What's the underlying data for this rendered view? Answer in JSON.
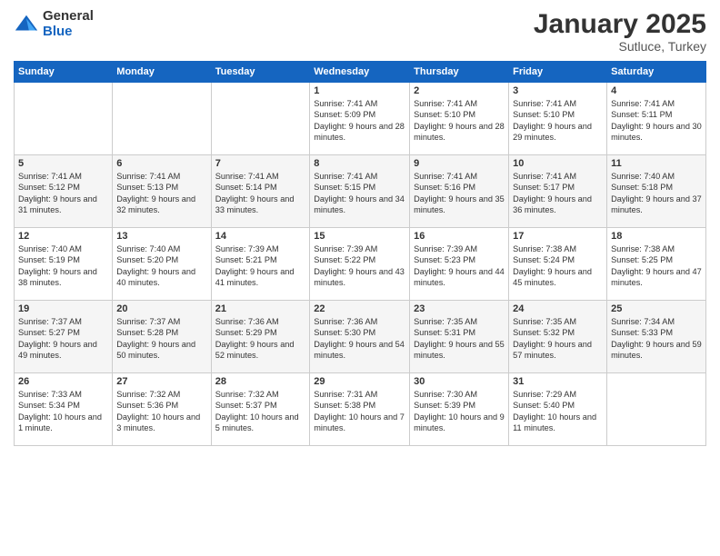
{
  "logo": {
    "general": "General",
    "blue": "Blue"
  },
  "header": {
    "month": "January 2025",
    "location": "Sutluce, Turkey"
  },
  "days_of_week": [
    "Sunday",
    "Monday",
    "Tuesday",
    "Wednesday",
    "Thursday",
    "Friday",
    "Saturday"
  ],
  "weeks": [
    [
      {
        "day": "",
        "info": ""
      },
      {
        "day": "",
        "info": ""
      },
      {
        "day": "",
        "info": ""
      },
      {
        "day": "1",
        "info": "Sunrise: 7:41 AM\nSunset: 5:09 PM\nDaylight: 9 hours and 28 minutes."
      },
      {
        "day": "2",
        "info": "Sunrise: 7:41 AM\nSunset: 5:10 PM\nDaylight: 9 hours and 28 minutes."
      },
      {
        "day": "3",
        "info": "Sunrise: 7:41 AM\nSunset: 5:10 PM\nDaylight: 9 hours and 29 minutes."
      },
      {
        "day": "4",
        "info": "Sunrise: 7:41 AM\nSunset: 5:11 PM\nDaylight: 9 hours and 30 minutes."
      }
    ],
    [
      {
        "day": "5",
        "info": "Sunrise: 7:41 AM\nSunset: 5:12 PM\nDaylight: 9 hours and 31 minutes."
      },
      {
        "day": "6",
        "info": "Sunrise: 7:41 AM\nSunset: 5:13 PM\nDaylight: 9 hours and 32 minutes."
      },
      {
        "day": "7",
        "info": "Sunrise: 7:41 AM\nSunset: 5:14 PM\nDaylight: 9 hours and 33 minutes."
      },
      {
        "day": "8",
        "info": "Sunrise: 7:41 AM\nSunset: 5:15 PM\nDaylight: 9 hours and 34 minutes."
      },
      {
        "day": "9",
        "info": "Sunrise: 7:41 AM\nSunset: 5:16 PM\nDaylight: 9 hours and 35 minutes."
      },
      {
        "day": "10",
        "info": "Sunrise: 7:41 AM\nSunset: 5:17 PM\nDaylight: 9 hours and 36 minutes."
      },
      {
        "day": "11",
        "info": "Sunrise: 7:40 AM\nSunset: 5:18 PM\nDaylight: 9 hours and 37 minutes."
      }
    ],
    [
      {
        "day": "12",
        "info": "Sunrise: 7:40 AM\nSunset: 5:19 PM\nDaylight: 9 hours and 38 minutes."
      },
      {
        "day": "13",
        "info": "Sunrise: 7:40 AM\nSunset: 5:20 PM\nDaylight: 9 hours and 40 minutes."
      },
      {
        "day": "14",
        "info": "Sunrise: 7:39 AM\nSunset: 5:21 PM\nDaylight: 9 hours and 41 minutes."
      },
      {
        "day": "15",
        "info": "Sunrise: 7:39 AM\nSunset: 5:22 PM\nDaylight: 9 hours and 43 minutes."
      },
      {
        "day": "16",
        "info": "Sunrise: 7:39 AM\nSunset: 5:23 PM\nDaylight: 9 hours and 44 minutes."
      },
      {
        "day": "17",
        "info": "Sunrise: 7:38 AM\nSunset: 5:24 PM\nDaylight: 9 hours and 45 minutes."
      },
      {
        "day": "18",
        "info": "Sunrise: 7:38 AM\nSunset: 5:25 PM\nDaylight: 9 hours and 47 minutes."
      }
    ],
    [
      {
        "day": "19",
        "info": "Sunrise: 7:37 AM\nSunset: 5:27 PM\nDaylight: 9 hours and 49 minutes."
      },
      {
        "day": "20",
        "info": "Sunrise: 7:37 AM\nSunset: 5:28 PM\nDaylight: 9 hours and 50 minutes."
      },
      {
        "day": "21",
        "info": "Sunrise: 7:36 AM\nSunset: 5:29 PM\nDaylight: 9 hours and 52 minutes."
      },
      {
        "day": "22",
        "info": "Sunrise: 7:36 AM\nSunset: 5:30 PM\nDaylight: 9 hours and 54 minutes."
      },
      {
        "day": "23",
        "info": "Sunrise: 7:35 AM\nSunset: 5:31 PM\nDaylight: 9 hours and 55 minutes."
      },
      {
        "day": "24",
        "info": "Sunrise: 7:35 AM\nSunset: 5:32 PM\nDaylight: 9 hours and 57 minutes."
      },
      {
        "day": "25",
        "info": "Sunrise: 7:34 AM\nSunset: 5:33 PM\nDaylight: 9 hours and 59 minutes."
      }
    ],
    [
      {
        "day": "26",
        "info": "Sunrise: 7:33 AM\nSunset: 5:34 PM\nDaylight: 10 hours and 1 minute."
      },
      {
        "day": "27",
        "info": "Sunrise: 7:32 AM\nSunset: 5:36 PM\nDaylight: 10 hours and 3 minutes."
      },
      {
        "day": "28",
        "info": "Sunrise: 7:32 AM\nSunset: 5:37 PM\nDaylight: 10 hours and 5 minutes."
      },
      {
        "day": "29",
        "info": "Sunrise: 7:31 AM\nSunset: 5:38 PM\nDaylight: 10 hours and 7 minutes."
      },
      {
        "day": "30",
        "info": "Sunrise: 7:30 AM\nSunset: 5:39 PM\nDaylight: 10 hours and 9 minutes."
      },
      {
        "day": "31",
        "info": "Sunrise: 7:29 AM\nSunset: 5:40 PM\nDaylight: 10 hours and 11 minutes."
      },
      {
        "day": "",
        "info": ""
      }
    ]
  ]
}
